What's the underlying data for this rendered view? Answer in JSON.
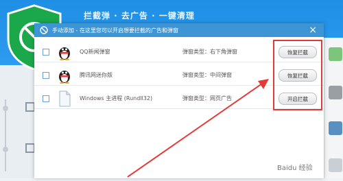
{
  "background": {
    "title_text": "拦截弹 · 去广告 · 一键清理",
    "colors": {
      "header": "#2c9bf0",
      "shield": "#1aa84a"
    }
  },
  "dialog": {
    "title": "手动添加 - 在这里您可以开启想要拦截的广告和弹窗",
    "close_glyph": "×",
    "type_prefix": "弹窗类型：",
    "rows": [
      {
        "name": "QQ新闻弹窗",
        "type": "右下角弹窗",
        "button": "恢复拦截",
        "icon": "qq-penguin-icon"
      },
      {
        "name": "腾讯网迷你版",
        "type": "中间弹窗",
        "button": "恢复拦截",
        "icon": "qq-penguin-icon"
      },
      {
        "name": "Windows 主进程 (Rundll32)",
        "type": "网页广告",
        "button": "开启拦截",
        "icon": "document-icon"
      }
    ]
  },
  "annotation": {
    "highlight_color": "#e53935"
  },
  "watermark": "Baidu 经验"
}
